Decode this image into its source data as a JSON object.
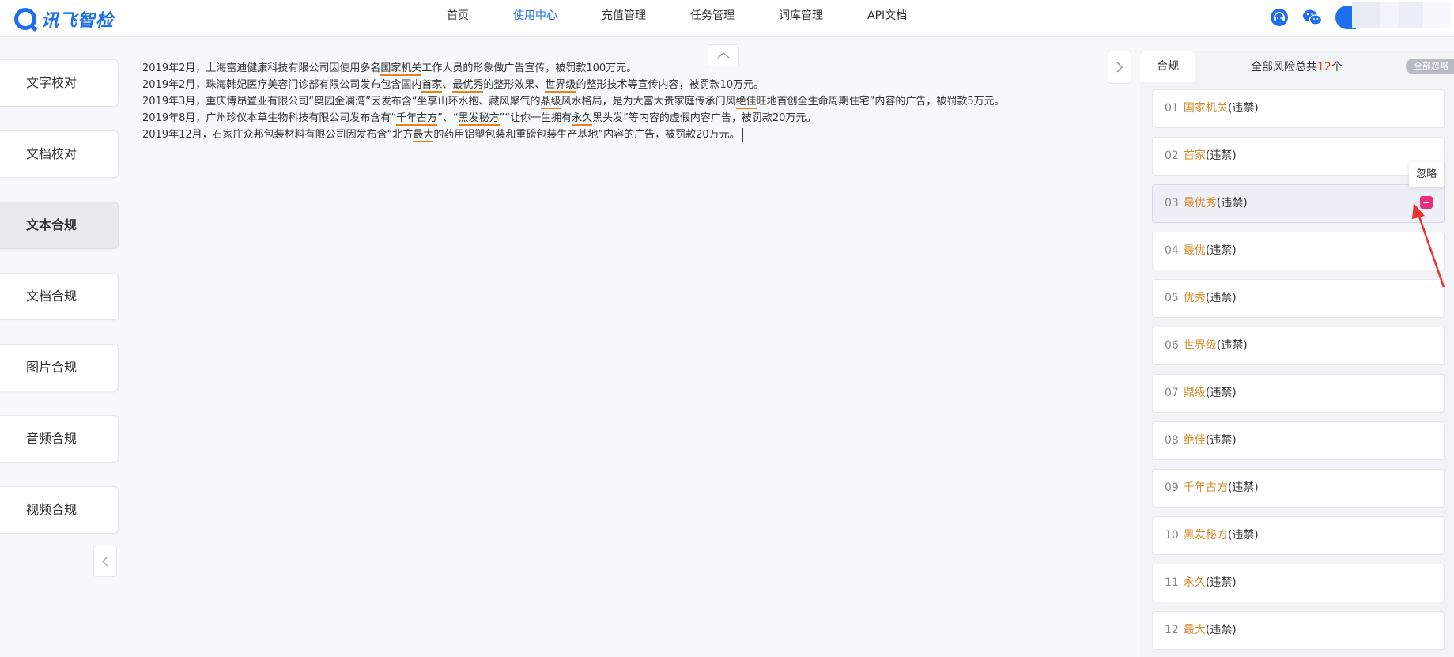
{
  "brand": {
    "name": "讯飞智检"
  },
  "nav": [
    {
      "label": "首页",
      "active": false
    },
    {
      "label": "使用中心",
      "active": true
    },
    {
      "label": "充值管理",
      "active": false
    },
    {
      "label": "任务管理",
      "active": false
    },
    {
      "label": "词库管理",
      "active": false
    },
    {
      "label": "API文档",
      "active": false
    }
  ],
  "header_icons": [
    "customer-service-icon",
    "wechat-icon",
    "user-avatar"
  ],
  "sidebar": {
    "items": [
      {
        "label": "文字校对",
        "active": false
      },
      {
        "label": "文档校对",
        "active": false
      },
      {
        "label": "文本合规",
        "active": true
      },
      {
        "label": "文档合规",
        "active": false
      },
      {
        "label": "图片合规",
        "active": false
      },
      {
        "label": "音频合规",
        "active": false
      },
      {
        "label": "视频合规",
        "active": false
      }
    ]
  },
  "document": {
    "lines": [
      [
        {
          "t": "2019年2月，上海富迪健康科技有限公司因使用多名"
        },
        {
          "t": "国家机关",
          "hl": true
        },
        {
          "t": "工作人员的形象做广告宣传，被罚款100万元。"
        }
      ],
      [
        {
          "t": "2019年2月，珠海韩妃医疗美容门诊部有限公司发布包含国内"
        },
        {
          "t": "首家",
          "hl": true
        },
        {
          "t": "、"
        },
        {
          "t": "最优秀",
          "hl": true
        },
        {
          "t": "的整形效果、"
        },
        {
          "t": "世界级",
          "hl": true
        },
        {
          "t": "的整形技术等宣传内容，被罚款10万元。"
        }
      ],
      [
        {
          "t": "2019年3月，重庆博昂置业有限公司“奥园金澜湾”因发布含“坐享山环水抱、藏风聚气的"
        },
        {
          "t": "鼎级",
          "hl": true
        },
        {
          "t": "风水格局，是为大富大贵家庭传承门风"
        },
        {
          "t": "绝佳",
          "hl": true
        },
        {
          "t": "旺地首创全生命周期住宅”内容的广告，被罚款5万元。"
        }
      ],
      [
        {
          "t": "2019年8月，广州珍仪本草生物科技有限公司发布含有“"
        },
        {
          "t": "千年古方",
          "hl": true
        },
        {
          "t": "”、“"
        },
        {
          "t": "黑发秘方",
          "hl": true
        },
        {
          "t": "”“让你一生拥有"
        },
        {
          "t": "永久",
          "hl": true
        },
        {
          "t": "黑头发”等内容的虚假内容广告，被罚款20万元。"
        }
      ],
      [
        {
          "t": "2019年12月，石家庄众邦包装材料有限公司因发布含“北方"
        },
        {
          "t": "最大",
          "hl": true
        },
        {
          "t": "的药用铝塑包装和重磅包装生产基地”内容的广告，被罚款20万元。"
        }
      ]
    ]
  },
  "right_panel": {
    "tab_label": "合规",
    "risk_prefix": "全部风险总共",
    "risk_count": "12",
    "risk_suffix": "个",
    "ignore_all_label": "全部忽略",
    "tooltip": "忽略",
    "items": [
      {
        "no": "01",
        "keyword": "国家机关",
        "tag": "(违禁)"
      },
      {
        "no": "02",
        "keyword": "首家",
        "tag": "(违禁)"
      },
      {
        "no": "03",
        "keyword": "最优秀",
        "tag": "(违禁)",
        "active": true
      },
      {
        "no": "04",
        "keyword": "最优",
        "tag": "(违禁)"
      },
      {
        "no": "05",
        "keyword": "优秀",
        "tag": "(违禁)"
      },
      {
        "no": "06",
        "keyword": "世界级",
        "tag": "(违禁)"
      },
      {
        "no": "07",
        "keyword": "鼎级",
        "tag": "(违禁)"
      },
      {
        "no": "08",
        "keyword": "绝佳",
        "tag": "(违禁)"
      },
      {
        "no": "09",
        "keyword": "千年古方",
        "tag": "(违禁)"
      },
      {
        "no": "10",
        "keyword": "黑发秘方",
        "tag": "(违禁)"
      },
      {
        "no": "11",
        "keyword": "永久",
        "tag": "(违禁)"
      },
      {
        "no": "12",
        "keyword": "最大",
        "tag": "(违禁)"
      }
    ]
  },
  "colors": {
    "accent": "#1e6ff0",
    "highlight": "#e8831c",
    "keyword": "#d98b2b",
    "count": "#e0442c",
    "ignore_button": "#e8307d",
    "annotation_arrow": "#e8342f"
  }
}
